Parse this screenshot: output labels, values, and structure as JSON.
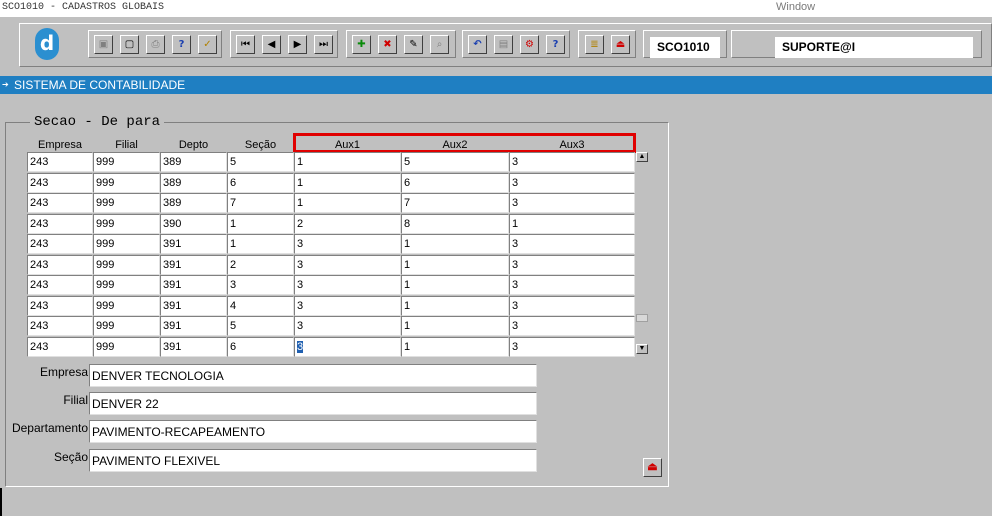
{
  "window": {
    "title": "SCO1010 - CADASTROS GLOBAIS",
    "menu": "Window"
  },
  "toolbar": {
    "logo_letter": "d",
    "program_code": "SCO1010",
    "user": "SUPORTE@I",
    "buttons": [
      {
        "name": "save-button",
        "glyph": "▣"
      },
      {
        "name": "window-button",
        "glyph": "▢"
      },
      {
        "name": "print-button",
        "glyph": "⎙"
      },
      {
        "name": "query-button",
        "glyph": "?"
      },
      {
        "name": "execute-query-button",
        "glyph": "✓"
      },
      {
        "name": "first-record-button",
        "glyph": "⏮"
      },
      {
        "name": "previous-record-button",
        "glyph": "◀"
      },
      {
        "name": "next-record-button",
        "glyph": "▶"
      },
      {
        "name": "last-record-button",
        "glyph": "⏭"
      },
      {
        "name": "insert-record-button",
        "glyph": "✚"
      },
      {
        "name": "delete-record-button",
        "glyph": "✖"
      },
      {
        "name": "edit-record-button",
        "glyph": "✎"
      },
      {
        "name": "lookup-button",
        "glyph": "⌕"
      },
      {
        "name": "undo-button",
        "glyph": "↶"
      },
      {
        "name": "copy-button",
        "glyph": "▤"
      },
      {
        "name": "tools-button",
        "glyph": "⚙"
      },
      {
        "name": "help-button",
        "glyph": "?"
      },
      {
        "name": "menu-button",
        "glyph": "≣"
      },
      {
        "name": "exit-button",
        "glyph": "⏏"
      }
    ]
  },
  "module_bar": {
    "label": "SISTEMA DE CONTABILIDADE"
  },
  "section": {
    "title": "Secao - De para",
    "columns": [
      "Empresa",
      "Filial",
      "Depto",
      "Seção",
      "Aux1",
      "Aux2",
      "Aux3"
    ],
    "rows": [
      [
        "243",
        "999",
        "389",
        "5",
        "1",
        "5",
        "3"
      ],
      [
        "243",
        "999",
        "389",
        "6",
        "1",
        "6",
        "3"
      ],
      [
        "243",
        "999",
        "389",
        "7",
        "1",
        "7",
        "3"
      ],
      [
        "243",
        "999",
        "390",
        "1",
        "2",
        "8",
        "1"
      ],
      [
        "243",
        "999",
        "391",
        "1",
        "3",
        "1",
        "3"
      ],
      [
        "243",
        "999",
        "391",
        "2",
        "3",
        "1",
        "3"
      ],
      [
        "243",
        "999",
        "391",
        "3",
        "3",
        "1",
        "3"
      ],
      [
        "243",
        "999",
        "391",
        "4",
        "3",
        "1",
        "3"
      ],
      [
        "243",
        "999",
        "391",
        "5",
        "3",
        "1",
        "3"
      ],
      [
        "243",
        "999",
        "391",
        "6",
        "3",
        "1",
        "3"
      ]
    ]
  },
  "details": {
    "empresa_label": "Empresa",
    "empresa_value": "DENVER TECNOLOGIA",
    "filial_label": "Filial",
    "filial_value": "DENVER 22",
    "departamento_label": "Departamento",
    "departamento_value": "PAVIMENTO-RECAPEAMENTO",
    "secao_label": "Seção",
    "secao_value": "PAVIMENTO FLEXIVEL"
  },
  "colors": {
    "module_bar": "#1f7fc2",
    "highlight_border": "#e00000",
    "background": "#c0c0c0"
  }
}
